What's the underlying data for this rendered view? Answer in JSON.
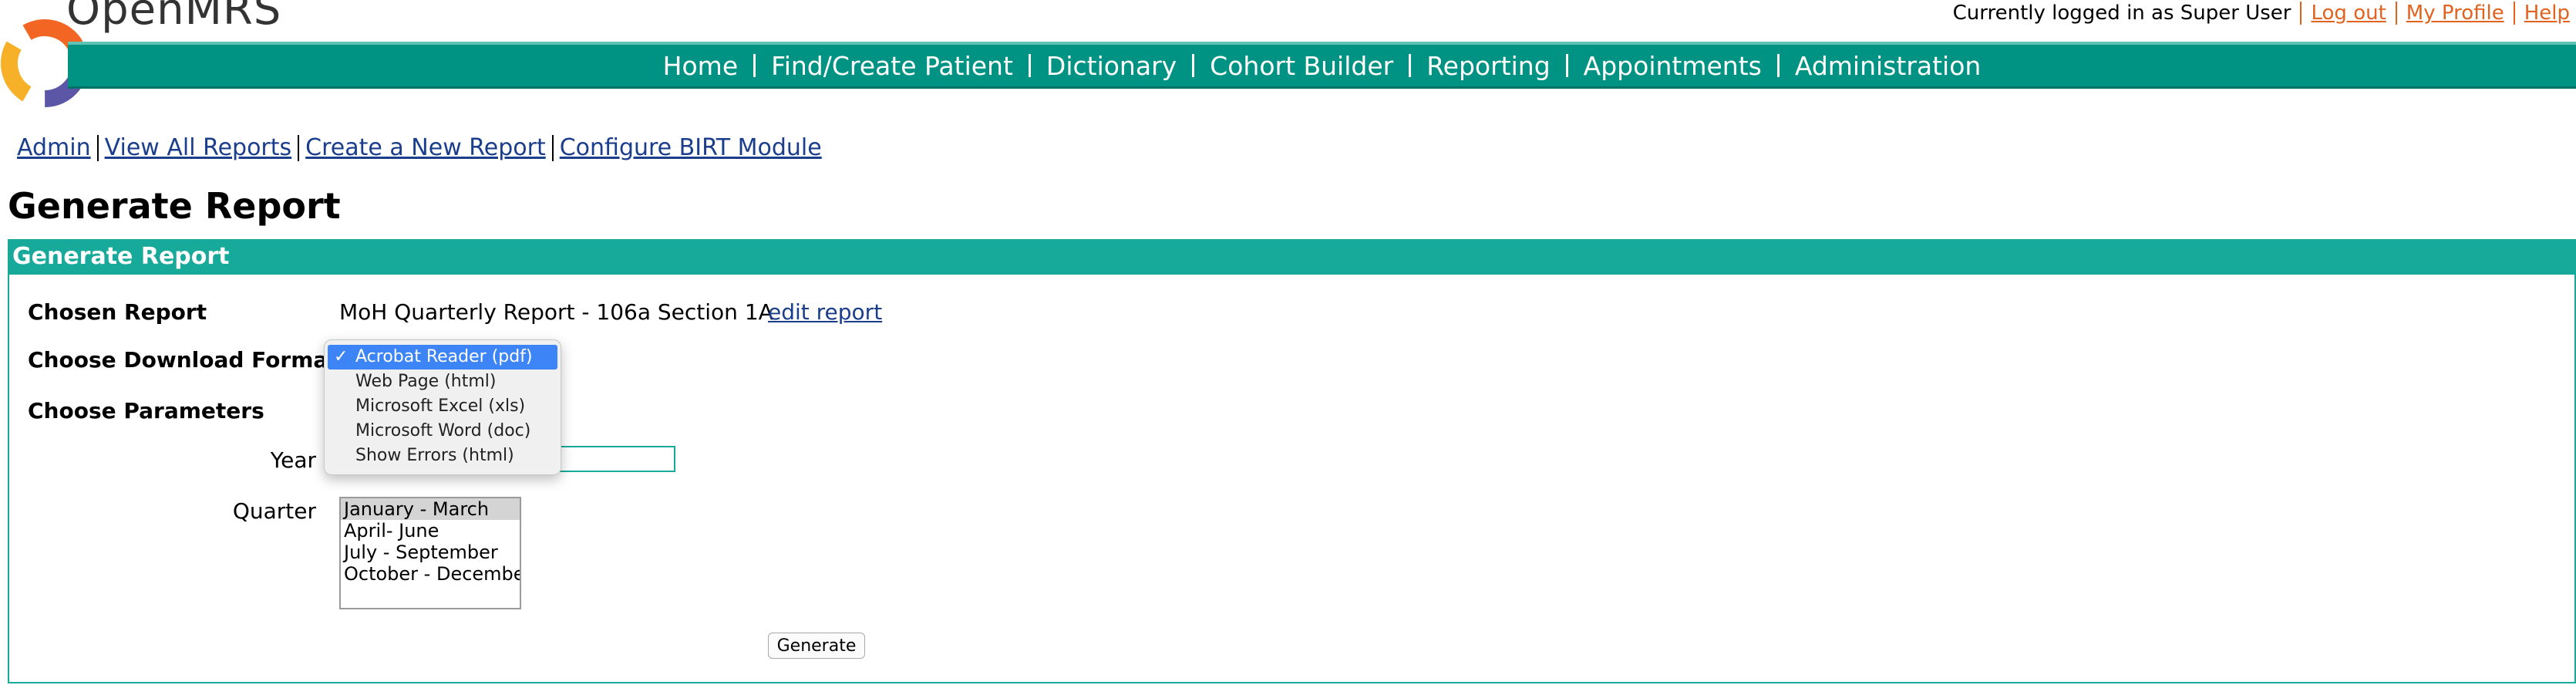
{
  "brand": {
    "name": "OpenMRS"
  },
  "user_bar": {
    "status": "Currently logged in as Super User",
    "logout": "Log out",
    "profile": "My Profile",
    "help": "Help"
  },
  "nav": {
    "items": [
      {
        "label": "Home"
      },
      {
        "label": "Find/Create Patient"
      },
      {
        "label": "Dictionary"
      },
      {
        "label": "Cohort Builder"
      },
      {
        "label": "Reporting"
      },
      {
        "label": "Appointments"
      },
      {
        "label": "Administration"
      }
    ]
  },
  "admin_links": {
    "admin": "Admin",
    "view_all": "View All Reports",
    "create_new": "Create a New Report",
    "configure": "Configure BIRT Module"
  },
  "page": {
    "title": "Generate Report"
  },
  "panel": {
    "header": "Generate Report",
    "chosen_report_label": "Chosen Report",
    "chosen_report_value": "MoH Quarterly Report - 106a Section 1A",
    "edit_report": "edit report",
    "download_format_label": "Choose Download Format",
    "parameters_label": "Choose Parameters",
    "year_label": "Year",
    "year_value": "",
    "quarter_label": "Quarter",
    "generate_button": "Generate"
  },
  "format_dropdown": {
    "options": [
      {
        "label": "Acrobat Reader (pdf)",
        "selected": true
      },
      {
        "label": "Web Page (html)"
      },
      {
        "label": "Microsoft Excel (xls)"
      },
      {
        "label": "Microsoft Word (doc)"
      },
      {
        "label": "Show Errors (html)"
      }
    ],
    "check_glyph": "✓"
  },
  "quarter_list": {
    "options": [
      {
        "label": "January - March",
        "selected": true
      },
      {
        "label": "April- June"
      },
      {
        "label": "July - September"
      },
      {
        "label": "October - December"
      }
    ]
  },
  "colors": {
    "nav_teal": "#009384",
    "panel_teal": "#17a999",
    "link_orange": "#e2631f",
    "dropdown_highlight": "#3d84f7",
    "logo_orange": "#f26522",
    "logo_purple": "#5b57a6"
  }
}
